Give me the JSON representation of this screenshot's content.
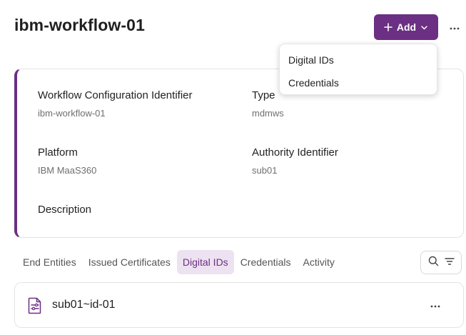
{
  "header": {
    "title": "ibm-workflow-01",
    "add_button_label": "Add",
    "accent_color": "#6b2f83"
  },
  "add_menu": {
    "items": [
      {
        "label": "Digital IDs"
      },
      {
        "label": "Credentials"
      }
    ]
  },
  "details": {
    "fields": [
      {
        "label": "Workflow Configuration Identifier",
        "value": "ibm-workflow-01"
      },
      {
        "label": "Type",
        "value": "mdmws"
      },
      {
        "label": "Platform",
        "value": "IBM MaaS360"
      },
      {
        "label": "Authority Identifier",
        "value": "sub01"
      },
      {
        "label": "Description",
        "value": ""
      }
    ]
  },
  "tabs": {
    "items": [
      {
        "label": "End Entities"
      },
      {
        "label": "Issued Certificates"
      },
      {
        "label": "Digital IDs"
      },
      {
        "label": "Credentials"
      },
      {
        "label": "Activity"
      }
    ],
    "active": "Digital IDs"
  },
  "list": {
    "items": [
      {
        "label": "sub01~id-01",
        "icon": "document-settings-icon"
      }
    ]
  },
  "icons": {
    "add": "plus-icon",
    "menu": "chevron-down-icon",
    "more": "more-horizontal-icon",
    "search": "search-icon",
    "filter": "filter-icon"
  }
}
